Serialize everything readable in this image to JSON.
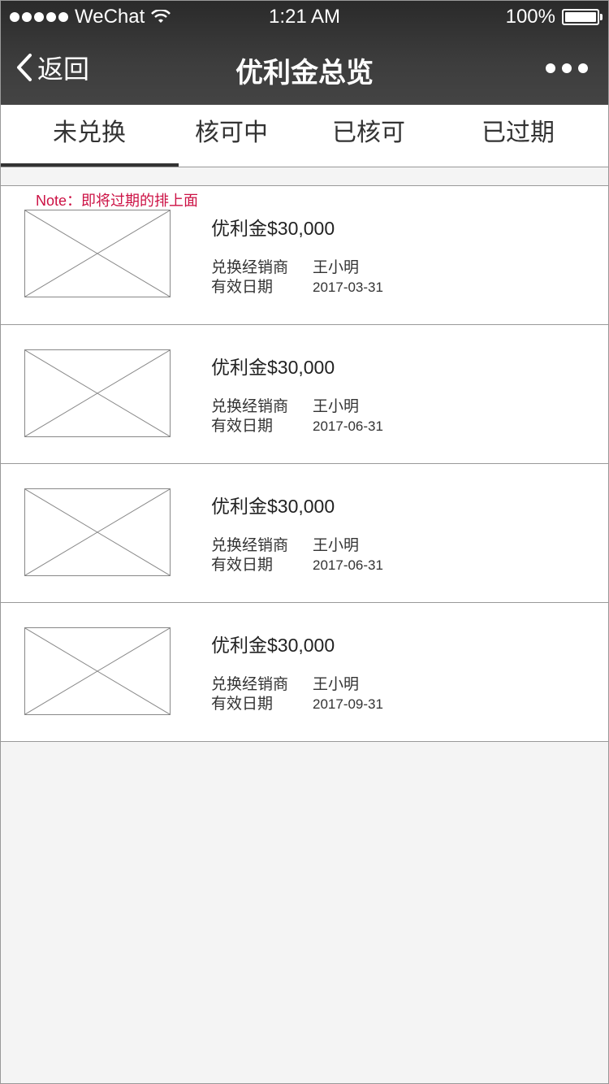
{
  "status": {
    "carrier": "WeChat",
    "time": "1:21 AM",
    "battery": "100%"
  },
  "nav": {
    "back_label": "返回",
    "title": "优利金总览"
  },
  "tabs": [
    {
      "label": "未兑换",
      "active": true
    },
    {
      "label": "核可中",
      "active": false
    },
    {
      "label": "已核可",
      "active": false
    },
    {
      "label": "已过期",
      "active": false
    }
  ],
  "note": "Note：即将过期的排上面",
  "items": [
    {
      "title": "优利金$30,000",
      "dealer_label": "兑换经销商",
      "dealer": "王小明",
      "date_label": "有效日期",
      "date": "2017-03-31"
    },
    {
      "title": "优利金$30,000",
      "dealer_label": "兑换经销商",
      "dealer": "王小明",
      "date_label": "有效日期",
      "date": "2017-06-31"
    },
    {
      "title": "优利金$30,000",
      "dealer_label": "兑换经销商",
      "dealer": "王小明",
      "date_label": "有效日期",
      "date": "2017-06-31"
    },
    {
      "title": "优利金$30,000",
      "dealer_label": "兑换经销商",
      "dealer": "王小明",
      "date_label": "有效日期",
      "date": "2017-09-31"
    }
  ],
  "icons": {
    "signal": "signal-dots-icon",
    "wifi": "wifi-icon",
    "battery": "battery-icon",
    "back": "chevron-left-icon",
    "more": "more-dots-icon",
    "placeholder": "image-placeholder-icon"
  }
}
